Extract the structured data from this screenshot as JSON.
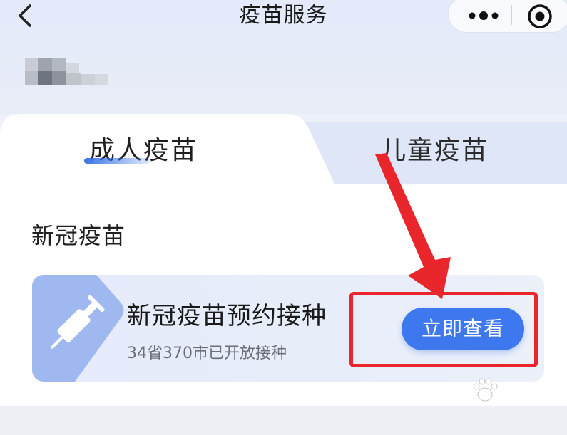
{
  "header": {
    "title": "疫苗服务"
  },
  "tabs": [
    {
      "label": "成人疫苗",
      "active": true
    },
    {
      "label": "儿童疫苗",
      "active": false
    }
  ],
  "section": {
    "title": "新冠疫苗"
  },
  "card": {
    "title": "新冠疫苗预约接种",
    "subtitle": "34省370市已开放接种",
    "button_label": "立即查看"
  },
  "colors": {
    "accent": "#3e78ee",
    "highlight": "#e8262b"
  },
  "icons": [
    "back-icon",
    "more-icon",
    "target-icon",
    "syringe-icon"
  ]
}
